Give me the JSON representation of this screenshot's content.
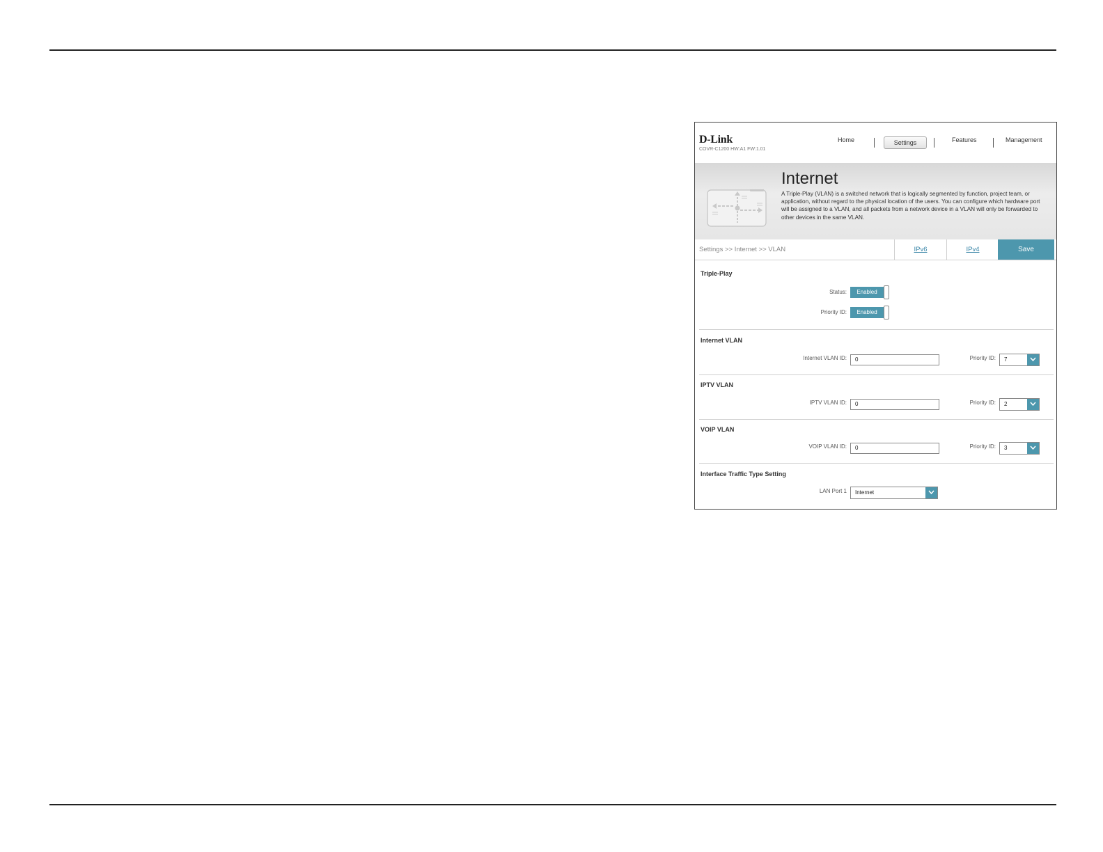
{
  "header": {
    "logo": "D-Link",
    "model": "COVR-C1200 HW:A1 FW:1.01",
    "nav": [
      {
        "label": "Home"
      },
      {
        "label": "Settings"
      },
      {
        "label": "Features"
      },
      {
        "label": "Management"
      }
    ],
    "active_nav": "Settings"
  },
  "banner": {
    "title": "Internet",
    "description": "A Triple-Play (VLAN) is a switched network that is logically segmented by function, project team, or application, without regard to the physical location of the users. You can configure which hardware port will be assigned to a VLAN, and all packets from a network device in a VLAN will only be forwarded to other devices in the same VLAN."
  },
  "breadcrumb": "Settings >> Internet >> VLAN",
  "toolbar": {
    "ipv6_label": "IPv6",
    "ipv4_label": "IPv4",
    "save_label": "Save"
  },
  "triple_play": {
    "title": "Triple-Play",
    "status_label": "Status:",
    "status_value": "Enabled",
    "priority_label": "Priority ID:",
    "priority_value": "Enabled"
  },
  "internet_vlan": {
    "title": "Internet VLAN",
    "id_label": "Internet VLAN ID:",
    "id_value": "0",
    "priority_label": "Priority ID:",
    "priority_value": "7"
  },
  "iptv_vlan": {
    "title": "IPTV VLAN",
    "id_label": "IPTV VLAN ID:",
    "id_value": "0",
    "priority_label": "Priority ID:",
    "priority_value": "2"
  },
  "voip_vlan": {
    "title": "VOIP VLAN",
    "id_label": "VOIP VLAN ID:",
    "id_value": "0",
    "priority_label": "Priority ID:",
    "priority_value": "3"
  },
  "interface_traffic": {
    "title": "Interface Traffic Type Setting",
    "lan_port_label": "LAN Port 1",
    "lan_port_value": "Internet"
  },
  "colors": {
    "accent": "#4d97ad",
    "link": "#3a86a8"
  }
}
